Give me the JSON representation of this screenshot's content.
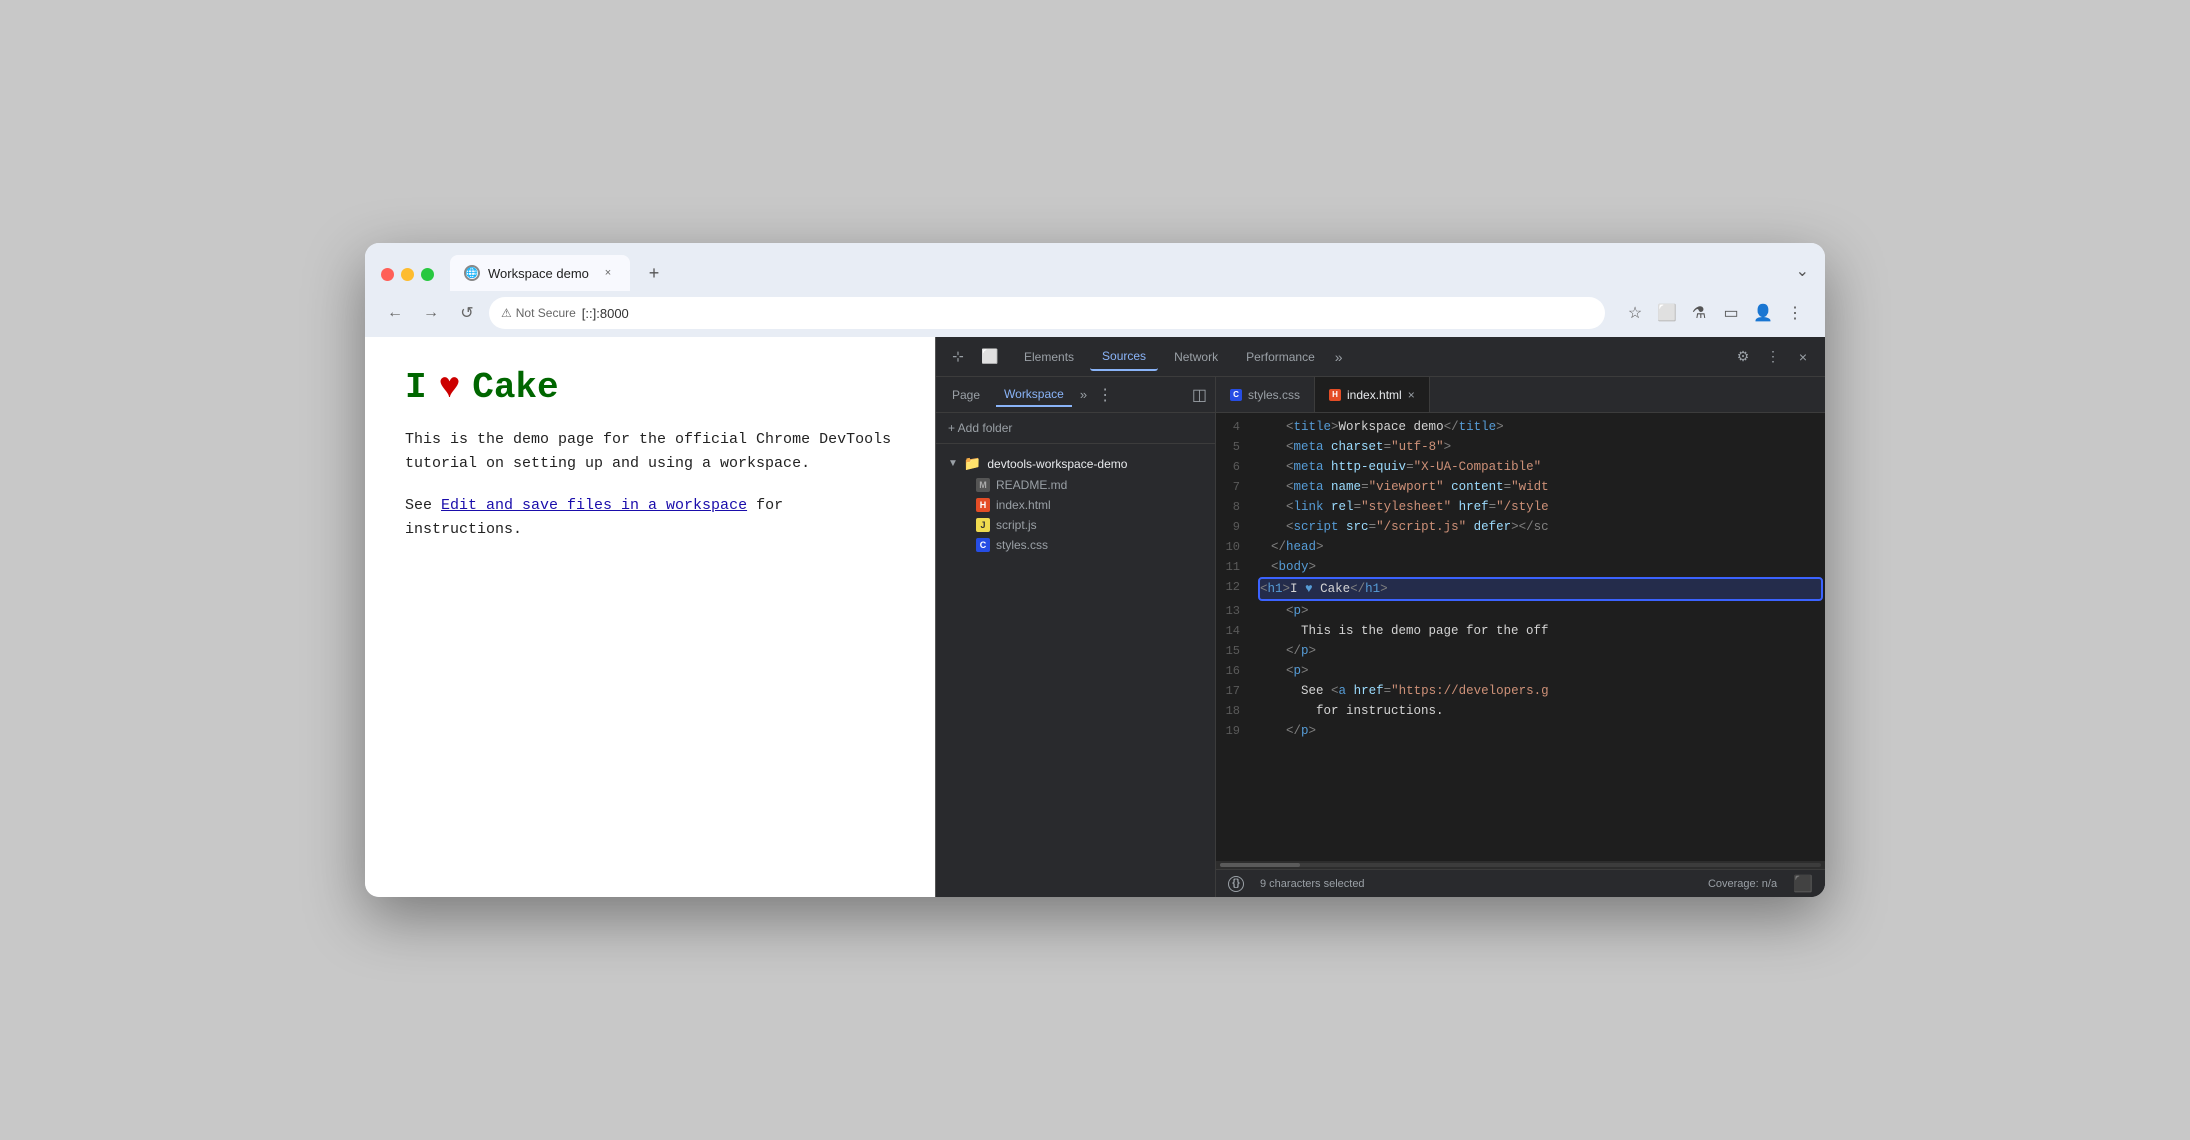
{
  "browser": {
    "tab_title": "Workspace demo",
    "tab_close": "×",
    "tab_new": "+",
    "tab_expand": "⌄"
  },
  "addressbar": {
    "nav_back": "←",
    "nav_forward": "→",
    "nav_refresh": "↺",
    "not_secure_icon": "⚠",
    "not_secure_label": "Not Secure",
    "url": "[::]​:8000",
    "bookmark_icon": "☆",
    "extension_icon": "⬜",
    "flask_icon": "⚗",
    "profile_icon": "👤",
    "more_icon": "⋮"
  },
  "page": {
    "heading_green": "I",
    "heading_cake": "Cake",
    "heart": "♥",
    "p1": "This is the demo page for the official Chrome DevTools tutorial on setting up and using a workspace.",
    "p2_prefix": "See ",
    "p2_link": "Edit and save files in a workspace",
    "p2_suffix": " for instructions."
  },
  "devtools": {
    "toolbar": {
      "cursor_icon": "⊹",
      "device_icon": "⬜",
      "tabs": [
        "Elements",
        "Sources",
        "Network",
        "Performance"
      ],
      "active_tab": "Sources",
      "more": "»",
      "settings_icon": "⚙",
      "dots_icon": "⋮",
      "close_icon": "×"
    },
    "sources": {
      "sidebar_tabs": [
        "Page",
        "Workspace"
      ],
      "active_sidebar_tab": "Workspace",
      "more_icon": "»",
      "dots_icon": "⋮",
      "toggle_icon": "◫",
      "add_folder_label": "+ Add folder",
      "folder_name": "devtools-workspace-demo",
      "files": [
        {
          "name": "README.md",
          "type": "md"
        },
        {
          "name": "index.html",
          "type": "html"
        },
        {
          "name": "script.js",
          "type": "js"
        },
        {
          "name": "styles.css",
          "type": "css"
        }
      ],
      "editor_tabs": [
        {
          "name": "styles.css",
          "type": "css"
        },
        {
          "name": "index.html",
          "type": "html",
          "active": true
        }
      ]
    },
    "code": {
      "lines": [
        {
          "num": 4,
          "content": "    <title>Workspace demo</title>"
        },
        {
          "num": 5,
          "content": "    <meta charset=\"utf-8\">"
        },
        {
          "num": 6,
          "content": "    <meta http-equiv=\"X-UA-Compatible\""
        },
        {
          "num": 7,
          "content": "    <meta name=\"viewport\" content=\"widt"
        },
        {
          "num": 8,
          "content": "    <link rel=\"stylesheet\" href=\"/style"
        },
        {
          "num": 9,
          "content": "    <script src=\"/script.js\" defer></sc"
        },
        {
          "num": 10,
          "content": "  </head>"
        },
        {
          "num": 11,
          "content": "  <body>"
        },
        {
          "num": 12,
          "content": "    <h1>I ♥ Cake</h1>",
          "highlighted": true
        },
        {
          "num": 13,
          "content": "    <p>"
        },
        {
          "num": 14,
          "content": "      This is the demo page for the off"
        },
        {
          "num": 15,
          "content": "    </p>"
        },
        {
          "num": 16,
          "content": "    <p>"
        },
        {
          "num": 17,
          "content": "      See <a href=\"https://developers.g"
        },
        {
          "num": 18,
          "content": "        for instructions."
        },
        {
          "num": 19,
          "content": "    </p>"
        }
      ]
    },
    "status": {
      "brace_icon": "{}",
      "selected_text": "9 characters selected",
      "coverage": "Coverage: n/a"
    }
  },
  "colors": {
    "active_tab_blue": "#8ab4f8",
    "highlight_border": "#3b63ff",
    "green_text": "#006600",
    "heart_red": "#cc0000",
    "link_blue": "#1a0dab"
  }
}
